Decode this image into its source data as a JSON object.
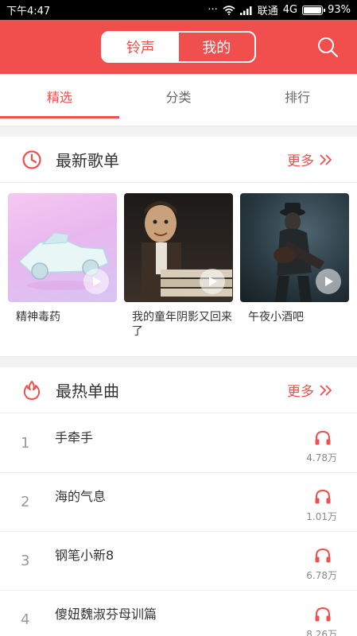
{
  "status": {
    "time": "下午4:47",
    "carrier": "联通",
    "network": "4G",
    "battery": "93%",
    "battery_level": 0.93
  },
  "header": {
    "seg_left": "铃声",
    "seg_right": "我的"
  },
  "tabs": [
    "精选",
    "分类",
    "排行"
  ],
  "section1": {
    "title": "最新歌单",
    "more": "更多"
  },
  "playlists": [
    {
      "name": "精神毒药"
    },
    {
      "name": "我的童年阴影又回来了"
    },
    {
      "name": "午夜小酒吧"
    }
  ],
  "section2": {
    "title": "最热单曲",
    "more": "更多"
  },
  "songs": [
    {
      "index": "1",
      "title": "手牵手",
      "count": "4.78万"
    },
    {
      "index": "2",
      "title": "海的气息",
      "count": "1.01万"
    },
    {
      "index": "3",
      "title": "钢笔小新8",
      "count": "6.78万"
    },
    {
      "index": "4",
      "title": "傻妞魏淑芬母训篇",
      "count": "8.26万"
    }
  ],
  "colors": {
    "accent": "#f14e4e"
  }
}
